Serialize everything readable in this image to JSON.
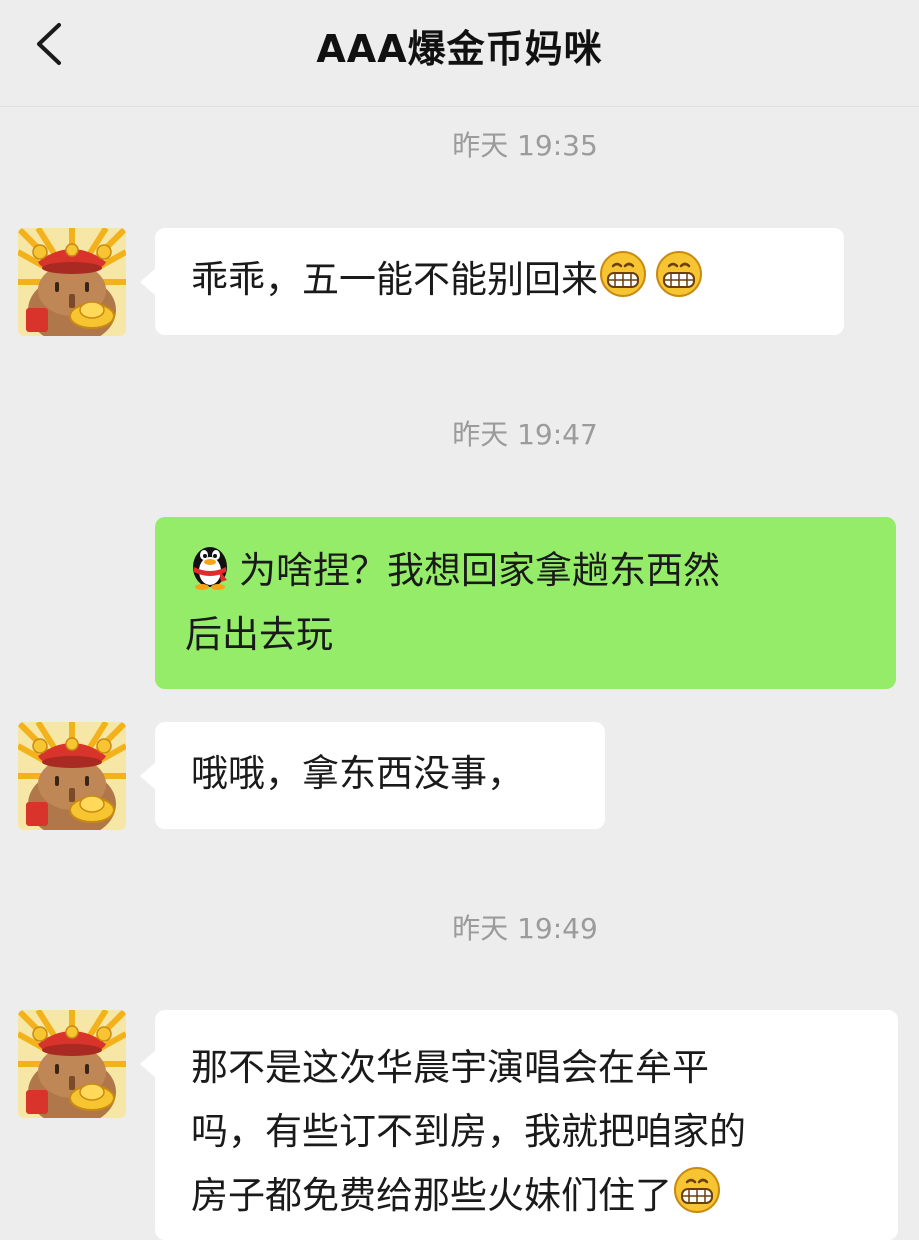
{
  "header": {
    "title": "AAA爆金币妈咪"
  },
  "messages": [
    {
      "type": "time",
      "text": "昨天 19:35"
    },
    {
      "type": "in",
      "text": "乖乖，五一能不能别回来",
      "trailing_emojis": [
        "grin-emoji",
        "grin-emoji"
      ]
    },
    {
      "type": "time",
      "text": "昨天 19:47"
    },
    {
      "type": "out",
      "leading_emoji": "qq-penguin-emoji",
      "line1": "为啥捏？我想回家拿趟东西然",
      "line2": "后出去玩"
    },
    {
      "type": "in",
      "text": "哦哦，拿东西没事，"
    },
    {
      "type": "time",
      "text": "昨天 19:49"
    },
    {
      "type": "in",
      "line1": "那不是这次华晨宇演唱会在牟平",
      "line2": "吗，有些订不到房，我就把咱家的",
      "line3": "房子都免费给那些火妹们住了",
      "trailing_emojis": [
        "grin-emoji"
      ]
    }
  ],
  "colors": {
    "background": "#ededed",
    "incoming_bubble": "#ffffff",
    "outgoing_bubble": "#95ec69",
    "timestamp": "#9b9b9b"
  },
  "avatar": {
    "icon": "capybara-avatar-icon"
  }
}
